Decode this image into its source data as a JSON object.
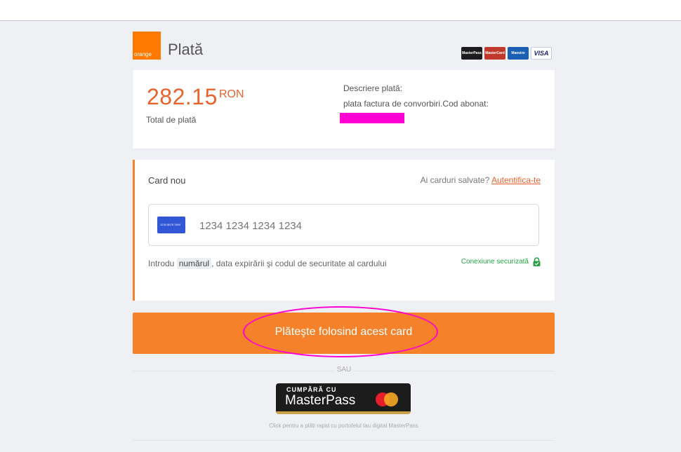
{
  "header": {
    "logo_text": "orange",
    "title": "Plată",
    "card_logos": [
      "MasterPass",
      "MasterCard",
      "Maestro",
      "VISA"
    ]
  },
  "summary": {
    "amount": "282.15",
    "currency": "RON",
    "amount_label": "Total de plată",
    "description_label": "Descriere plată:",
    "description_text": "plata factura de convorbiri.Cod abonat:"
  },
  "card_form": {
    "title": "Card nou",
    "saved_prompt": "Ai carduri salvate?",
    "login_link": "Autentifica-te",
    "card_icon_text": "1234 5678 7890",
    "card_placeholder": "1234 1234 1234 1234",
    "hint_prefix": "Introdu",
    "hint_highlight": "numărul",
    "hint_suffix": ", data expirării şi codul de securitate al cardului",
    "secure_label": "Conexiune securizată"
  },
  "pay_button": {
    "label": "Plăteşte folosind acest card"
  },
  "alternative": {
    "separator": "SAU",
    "masterpass_small": "CUMPĂRĂ CU",
    "masterpass_big": "MasterPass",
    "caption": "Click pentru a plăti rapid cu portofelul tau digital MasterPass"
  },
  "colors": {
    "accent": "#f5822a",
    "amount": "#e8632c",
    "annotation": "#ff00d4",
    "secure": "#29a34a"
  }
}
